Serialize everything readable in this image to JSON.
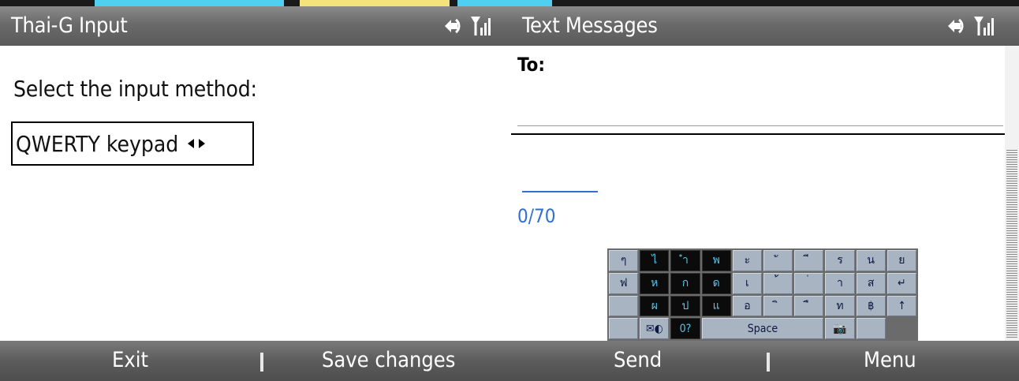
{
  "left": {
    "title": "Thai-G Input",
    "prompt": "Select the input method:",
    "picker_value": "QWERTY keypad",
    "softkeys": {
      "left": "Exit",
      "right": "Save changes"
    }
  },
  "right": {
    "title": "Text Messages",
    "to_label": "To:",
    "counter": "0/70",
    "softkeys": {
      "left": "Send",
      "right": "Menu"
    },
    "keyboard": {
      "rows": [
        [
          "ๆ",
          "ไ",
          "ำ",
          "พ",
          "ะ",
          "ั",
          "ี",
          "ร",
          "น",
          "ย"
        ],
        [
          "ฟ",
          "ห",
          "ก",
          "ด",
          "เ",
          "้",
          "่",
          "า",
          "ส",
          "↵"
        ],
        [
          "",
          "ผ",
          "ป",
          "แ",
          "อ",
          "ิ",
          "ื",
          "ท",
          "฿",
          "↑"
        ],
        [
          "",
          "✉◐",
          "0?",
          "Space",
          "📷",
          ""
        ]
      ]
    }
  },
  "icons": [
    "sync-icon",
    "signal-icon"
  ]
}
